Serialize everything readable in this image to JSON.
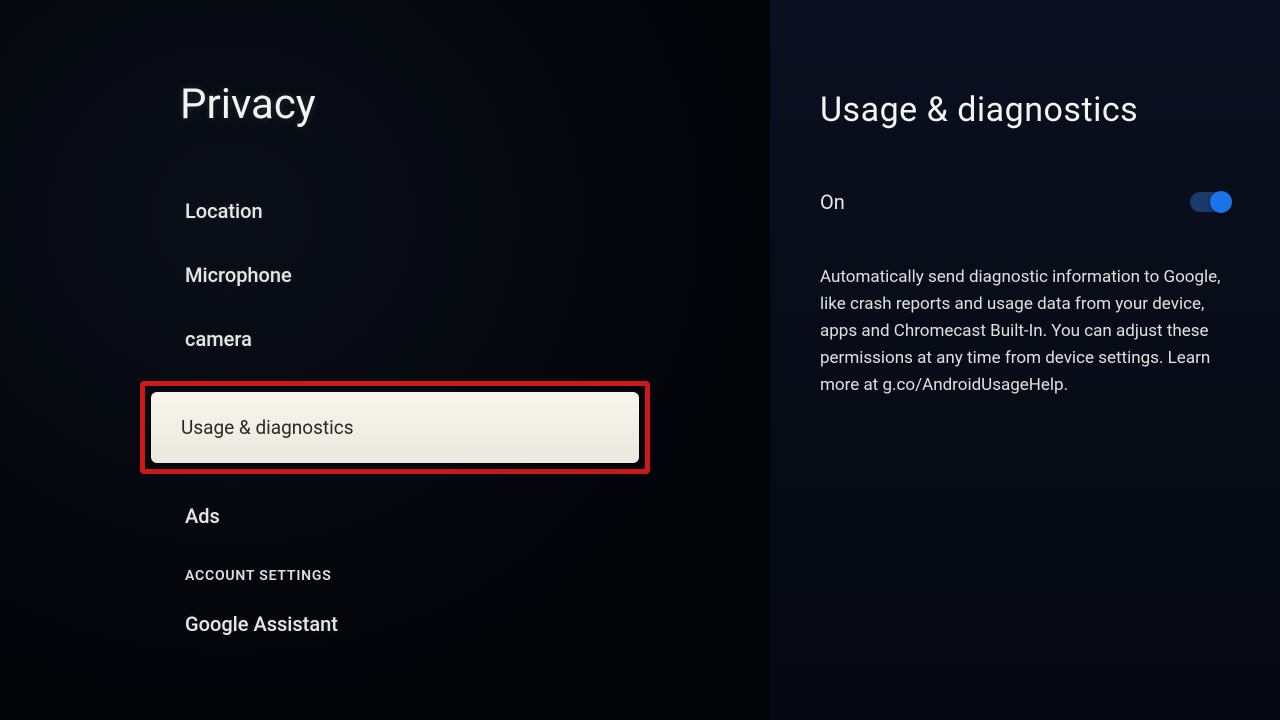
{
  "leftPanel": {
    "title": "Privacy",
    "items": [
      {
        "label": "Location",
        "type": "item"
      },
      {
        "label": "Microphone",
        "type": "item"
      },
      {
        "label": "camera",
        "type": "item"
      },
      {
        "label": "Usage & diagnostics",
        "type": "item",
        "selected": true
      },
      {
        "label": "Ads",
        "type": "item"
      },
      {
        "label": "ACCOUNT SETTINGS",
        "type": "header"
      },
      {
        "label": "Google Assistant",
        "type": "item"
      }
    ]
  },
  "rightPanel": {
    "title": "Usage & diagnostics",
    "toggleLabel": "On",
    "toggleState": "on",
    "description": "Automatically send diagnostic information to Google, like crash reports and usage data from your device, apps and Chromecast Built-In. You can adjust these permissions at any time from device settings. Learn more at g.co/AndroidUsageHelp."
  }
}
